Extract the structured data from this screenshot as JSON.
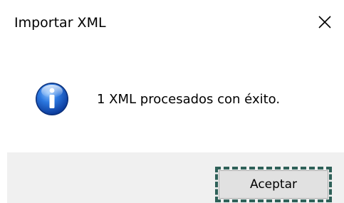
{
  "window": {
    "title": "Importar XML",
    "close_icon": "close-icon"
  },
  "content": {
    "icon": "info-icon",
    "message": "1 XML procesados con éxito."
  },
  "footer": {
    "ok_label": "Aceptar"
  },
  "colors": {
    "footer_bg": "#f0f0f0",
    "focus_outline": "#2f6159",
    "icon_blue": "#1e64c8"
  }
}
